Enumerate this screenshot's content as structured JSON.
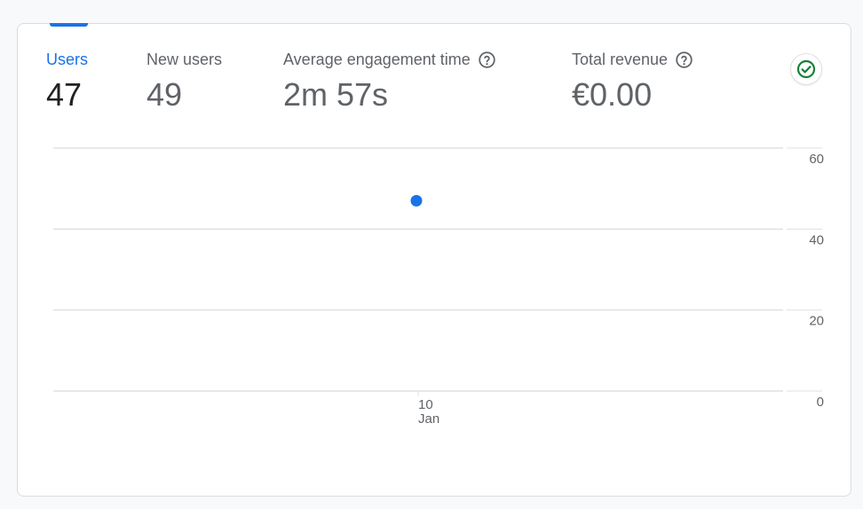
{
  "metrics": [
    {
      "label": "Users",
      "value": "47",
      "active": true,
      "help": false
    },
    {
      "label": "New users",
      "value": "49",
      "active": false,
      "help": false
    },
    {
      "label": "Average engagement time",
      "value": "2m 57s",
      "active": false,
      "help": true
    },
    {
      "label": "Total revenue",
      "value": "€0.00",
      "active": false,
      "help": true
    }
  ],
  "status_icon": "check-circle-icon",
  "colors": {
    "accent": "#1a73e8",
    "check": "#188038",
    "grid": "#e0e0e0",
    "muted_text": "#5f6368",
    "primary_text": "#202124"
  },
  "chart_data": {
    "type": "scatter",
    "series": [
      {
        "x": [
          "10 Jan"
        ],
        "values": [
          47
        ]
      }
    ],
    "x_tick_labels": [
      [
        "10",
        "Jan"
      ]
    ],
    "y_ticks": [
      0,
      20,
      40,
      60
    ],
    "ylim": [
      0,
      60
    ],
    "grid": true,
    "y_axis_position": "right",
    "title": "",
    "xlabel": "",
    "ylabel": ""
  }
}
